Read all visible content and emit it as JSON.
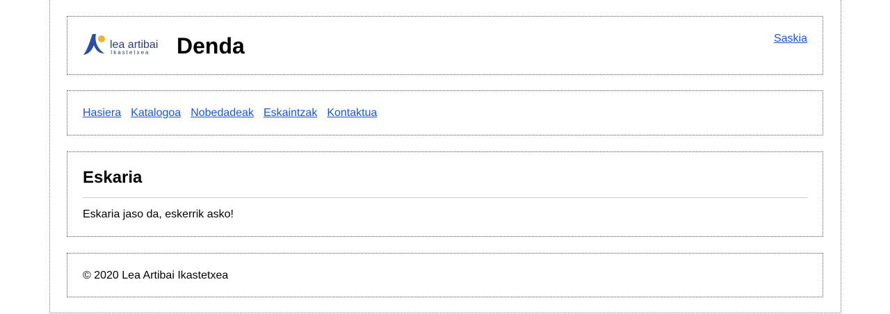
{
  "header": {
    "logo": {
      "text": "lea artibai",
      "subtext": "Ikastetxea",
      "icon": "lea-artibai-logo-icon",
      "colors": {
        "blue": "#2a4ea6",
        "yellow": "#f2b233"
      }
    },
    "site_title": "Denda",
    "cart_link": "Saskia"
  },
  "nav": {
    "items": [
      {
        "label": "Hasiera"
      },
      {
        "label": "Katalogoa"
      },
      {
        "label": "Nobedadeak"
      },
      {
        "label": "Eskaintzak"
      },
      {
        "label": "Kontaktua"
      }
    ]
  },
  "main": {
    "title": "Eskaria",
    "message": "Eskaria jaso da, eskerrik asko!"
  },
  "footer": {
    "copyright": "© 2020 Lea Artibai Ikastetxea"
  },
  "colors": {
    "link": "#1a55d6",
    "border": "#555555"
  }
}
